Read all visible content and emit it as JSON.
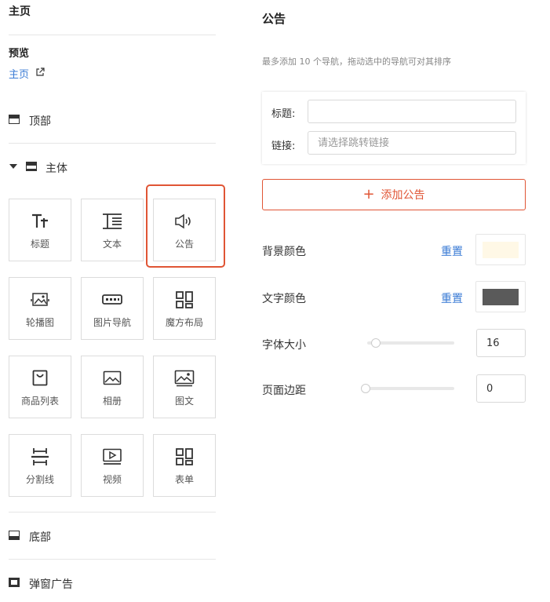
{
  "left": {
    "home_title": "主页",
    "preview_label": "预览",
    "preview_link": "主页",
    "sections": {
      "top": "顶部",
      "main": "主体",
      "bottom": "底部",
      "popup": "弹窗广告"
    },
    "components": [
      {
        "label": "标题",
        "icon": "title-icon"
      },
      {
        "label": "文本",
        "icon": "text-icon"
      },
      {
        "label": "公告",
        "icon": "announcement-icon",
        "selected": true
      },
      {
        "label": "轮播图",
        "icon": "carousel-icon"
      },
      {
        "label": "图片导航",
        "icon": "image-nav-icon"
      },
      {
        "label": "魔方布局",
        "icon": "cube-layout-icon"
      },
      {
        "label": "商品列表",
        "icon": "product-list-icon"
      },
      {
        "label": "相册",
        "icon": "album-icon"
      },
      {
        "label": "图文",
        "icon": "image-text-icon"
      },
      {
        "label": "分割线",
        "icon": "divider-icon"
      },
      {
        "label": "视频",
        "icon": "video-icon"
      },
      {
        "label": "表单",
        "icon": "form-icon"
      }
    ]
  },
  "right": {
    "title": "公告",
    "hint": "最多添加 10 个导航，拖动选中的导航可对其排序",
    "form": {
      "title_label": "标题:",
      "title_value": "",
      "link_label": "链接:",
      "link_placeholder": "请选择跳转链接"
    },
    "add_button": "添加公告",
    "add_icon": "+",
    "bg_color": {
      "label": "背景颜色",
      "reset": "重置",
      "color": "#fff8e6"
    },
    "text_color": {
      "label": "文字颜色",
      "reset": "重置",
      "color": "#5a5a5a"
    },
    "font_size": {
      "label": "字体大小",
      "value": "16"
    },
    "page_margin": {
      "label": "页面边距",
      "value": "0"
    },
    "accent_color": "#e05535"
  }
}
